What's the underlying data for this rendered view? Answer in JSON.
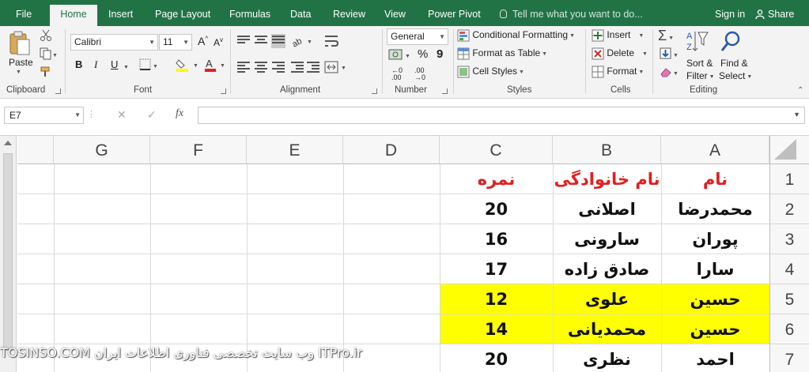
{
  "tabs": [
    "File",
    "Home",
    "Insert",
    "Page Layout",
    "Formulas",
    "Data",
    "Review",
    "View",
    "Power Pivot"
  ],
  "tell_me": "Tell me what you want to do...",
  "sign_in": "Sign in",
  "share": "Share",
  "ribbon": {
    "clipboard": {
      "label": "Clipboard",
      "paste": "Paste"
    },
    "font": {
      "label": "Font",
      "name": "Calibri",
      "size": "11",
      "bold": "B",
      "italic": "I",
      "underline": "U"
    },
    "alignment": {
      "label": "Alignment"
    },
    "number": {
      "label": "Number",
      "format": "General",
      "currency": "$",
      "percent": "%",
      "comma": "9"
    },
    "styles": {
      "label": "Styles",
      "conditional": "Conditional Formatting",
      "format_table": "Format as Table",
      "cell_styles": "Cell Styles"
    },
    "cells": {
      "label": "Cells",
      "insert": "Insert",
      "delete": "Delete",
      "format": "Format"
    },
    "editing": {
      "label": "Editing",
      "sort_1": "Sort &",
      "sort_2": "Filter",
      "find_1": "Find &",
      "find_2": "Select",
      "sigma": "Σ"
    }
  },
  "formula_bar": {
    "name_box": "E7",
    "cancel": "✕",
    "enter": "✓",
    "fx": "fx",
    "value": ""
  },
  "columns": [
    "A",
    "B",
    "C",
    "D",
    "E",
    "F",
    "G"
  ],
  "rows": [
    "1",
    "2",
    "3",
    "4",
    "5",
    "6",
    "7"
  ],
  "table": {
    "headers": [
      "نام",
      "نام خانوادگی",
      "نمره"
    ],
    "data": [
      [
        "محمدرضا",
        "اصلانی",
        "20"
      ],
      [
        "پوران",
        "سارونی",
        "16"
      ],
      [
        "سارا",
        "صادق زاده",
        "17"
      ],
      [
        "حسین",
        "علوی",
        "12"
      ],
      [
        "حسین",
        "محمدیانی",
        "14"
      ],
      [
        "احمد",
        "نظری",
        "20"
      ]
    ]
  },
  "watermark": "TOSINSO.COM وب سایت تخصصی فناوری اطلاعات ایران ITPro.ir",
  "colors": {
    "excel_green": "#217346",
    "highlight": "#ffff00",
    "header_red": "#e02020"
  }
}
